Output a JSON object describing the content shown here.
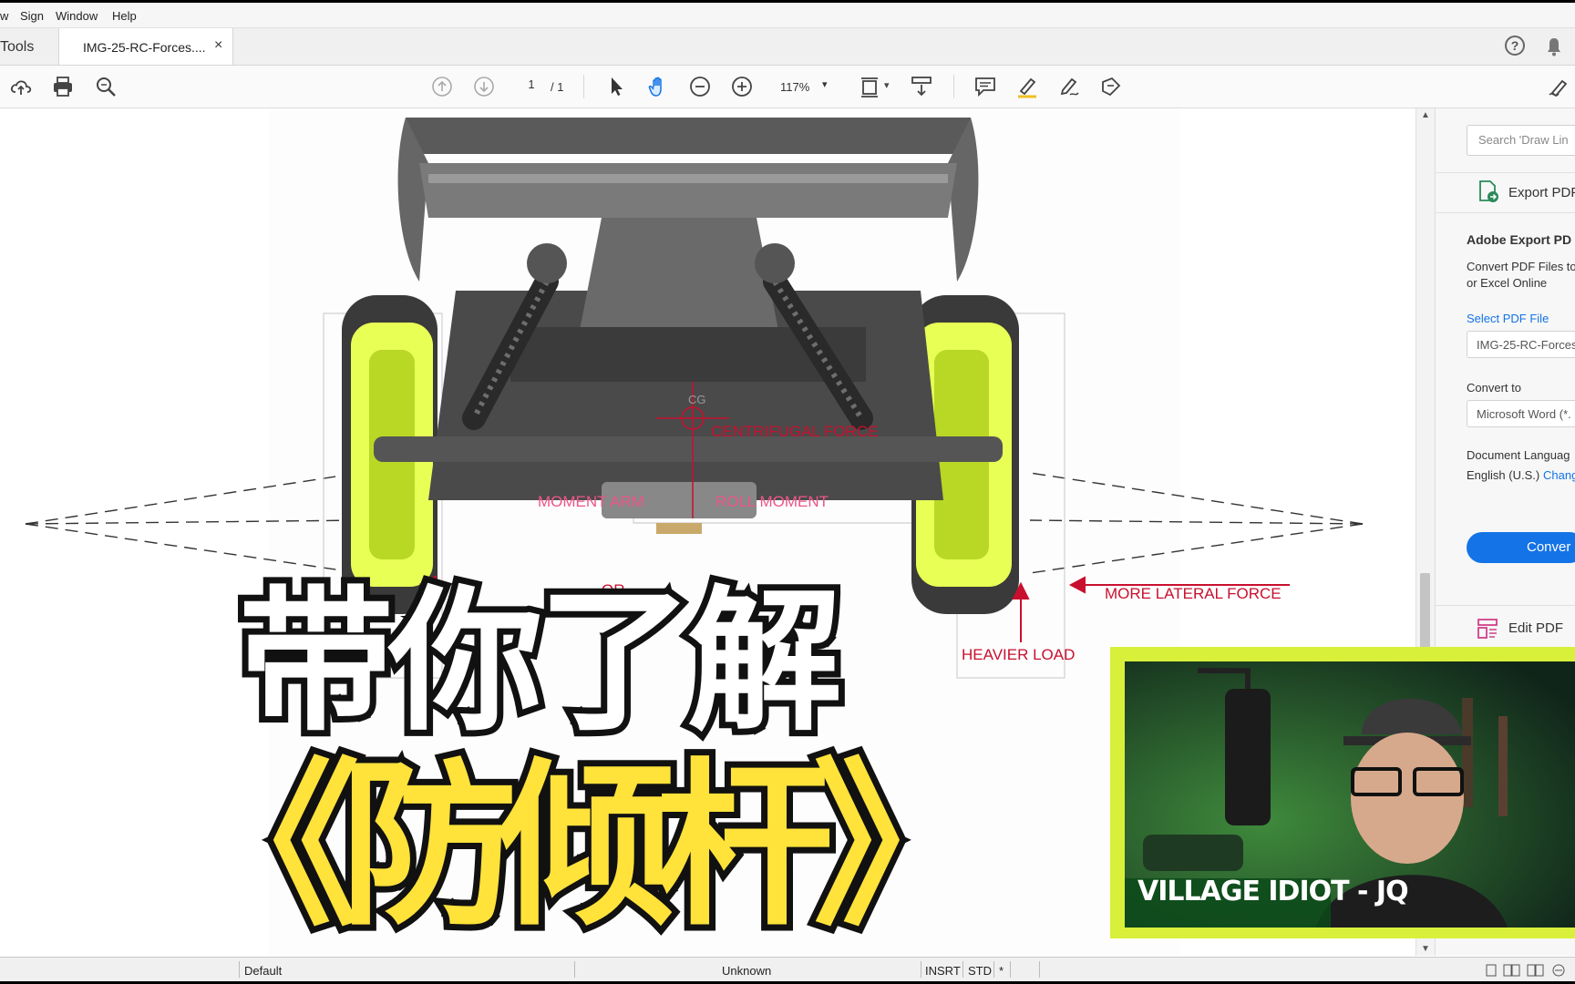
{
  "menu": [
    "w",
    "Sign",
    "Window",
    "Help"
  ],
  "tabs": {
    "tools": "Tools",
    "document": "IMG-25-RC-Forces....",
    "close": "×"
  },
  "toolbar": {
    "page_current": "1",
    "page_total": "/ 1",
    "zoom": "117%"
  },
  "diagram_labels": {
    "cg": "CG",
    "centrifugal": "CENTRIFUGAL FORCE",
    "moment_arm": "MOMENT ARM",
    "roll_moment": "ROLL MOMENT",
    "partial_left": "OR",
    "more_lateral": "MORE LATERAL FORCE",
    "heavier_load": "HEAVIER LOAD"
  },
  "overlay": {
    "line1": "带你了解",
    "line2": "《防倾杆》"
  },
  "right_panel": {
    "search_placeholder": "Search 'Draw Lin",
    "export_pdf": "Export PDF",
    "heading": "Adobe Export PD",
    "desc1": "Convert PDF Files to",
    "desc2": "or Excel Online",
    "select_file": "Select PDF File",
    "file_name": "IMG-25-RC-Forces",
    "convert_to": "Convert to",
    "format": "Microsoft Word (*.",
    "doc_language": "Document Languag",
    "language": "English (U.S.)",
    "change": "Chang",
    "convert_btn": "Conver",
    "edit_pdf": "Edit PDF"
  },
  "webcam": {
    "name": "VILLAGE IDIOT - JQ"
  },
  "status": {
    "default": "Default",
    "unknown": "Unknown",
    "insrt": "INSRT",
    "std": "STD",
    "star": "*"
  },
  "colors": {
    "accent_blue": "#1473e6",
    "diagram_red": "#c8102e",
    "overlay_yellow": "#ffe23a",
    "webcam_border": "#d8f03a"
  }
}
